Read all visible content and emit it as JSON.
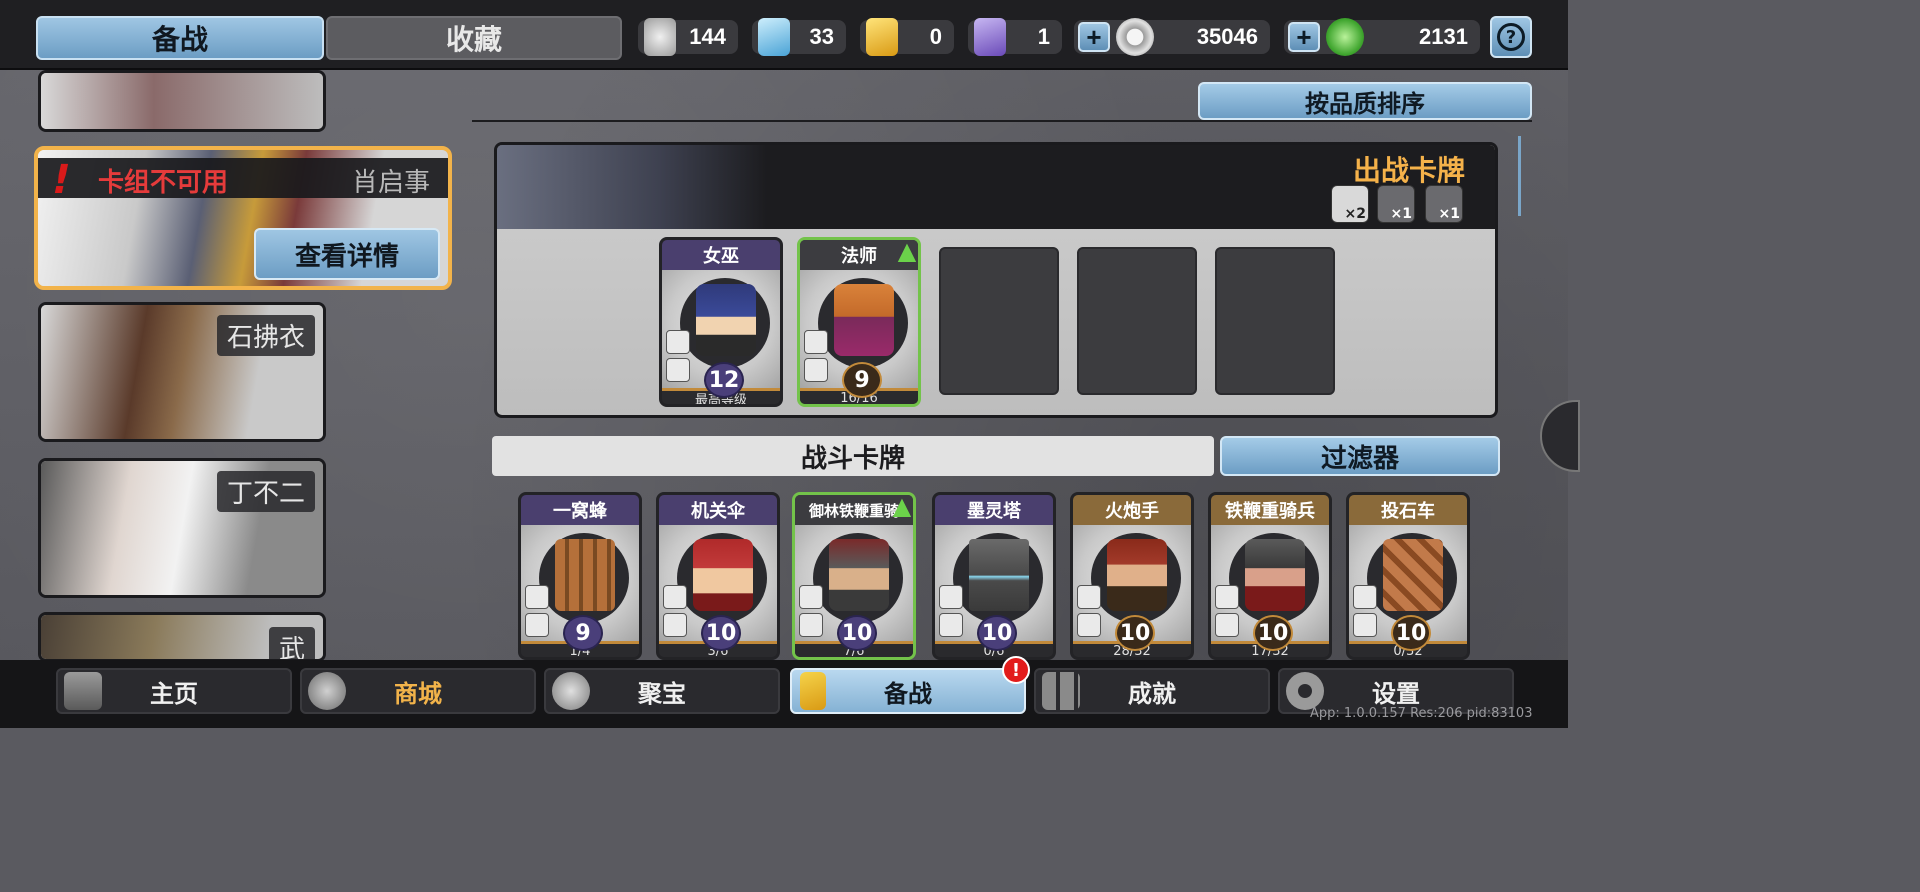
{
  "tabs": {
    "prepare": "备战",
    "collection": "收藏"
  },
  "resources": [
    {
      "icon": "silver-token-icon",
      "value": "144"
    },
    {
      "icon": "crystal-icon",
      "value": "33"
    },
    {
      "icon": "gold-shield-icon",
      "value": "0"
    },
    {
      "icon": "purple-crest-icon",
      "value": "1"
    }
  ],
  "currency_coin": {
    "icon": "coin-icon",
    "value": "35046"
  },
  "currency_gem": {
    "icon": "jade-gem-icon",
    "value": "2131"
  },
  "help_label": "?",
  "heroes": {
    "selected": {
      "warning": "卡组不可用",
      "name": "肖启事",
      "view_details": "查看详情"
    },
    "list": [
      {
        "name": "石拂衣"
      },
      {
        "name": "丁不二"
      },
      {
        "name": "武"
      }
    ]
  },
  "sort_label": "按品质排序",
  "deck": {
    "title": "出战卡牌",
    "limits": [
      "×2",
      "×1",
      "×1"
    ],
    "cards": [
      {
        "name": "女巫",
        "level": "12",
        "footer": "最高等级"
      },
      {
        "name": "法师",
        "level": "9",
        "footer": "16/16",
        "upgrade": "▲"
      }
    ]
  },
  "battle": {
    "title": "战斗卡牌",
    "filter": "过滤器",
    "cards": [
      {
        "name": "一窝蜂",
        "level": "9",
        "footer": "1/4"
      },
      {
        "name": "机关伞",
        "level": "10",
        "footer": "3/6"
      },
      {
        "name": "御林铁鞭重骑",
        "level": "10",
        "footer": "7/6",
        "upgrade": "▲"
      },
      {
        "name": "墨灵塔",
        "level": "10",
        "footer": "0/6"
      },
      {
        "name": "火炮手",
        "level": "10",
        "footer": "28/32"
      },
      {
        "name": "铁鞭重骑兵",
        "level": "10",
        "footer": "17/32"
      },
      {
        "name": "投石车",
        "level": "10",
        "footer": "0/32"
      }
    ]
  },
  "nav": {
    "home": "主页",
    "shop": "商城",
    "treasure": "聚宝",
    "prepare": "备战",
    "achievements": "成就",
    "settings": "设置",
    "badge": "!"
  },
  "app_info": "App: 1.0.0.157 Res:206 pid:83103",
  "colors": {
    "accent": "#9fc6e3",
    "highlight": "#f2b34a",
    "warning": "#e53b3b",
    "upgrade": "#73c34a"
  }
}
